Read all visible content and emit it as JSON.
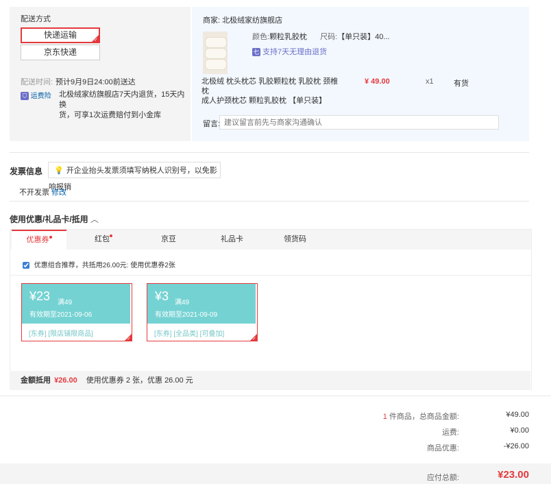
{
  "shipping": {
    "title": "配送方式",
    "options": [
      "快递运输",
      "京东快递"
    ],
    "selected_index": 0,
    "delivery_time_label": "配送时间:",
    "delivery_time_value": "预计9月9日24:00前送达",
    "insurance_badge": "运费险",
    "insurance_text_line1": "北极绒家纺旗舰店7天内退货，15天内换",
    "insurance_text_line2": "货，可享1次运费赔付到小金库"
  },
  "order": {
    "merchant_label": "商家:",
    "merchant_name": "北极绒家纺旗舰店",
    "color_label": "颜色:",
    "color_value": "颗粒乳胶枕",
    "size_label": "尺码:",
    "size_value": "【单只装】40...",
    "return_badge": "七",
    "return_text": "支持7天无理由退货",
    "product_title_line1": "北极绒 枕头枕芯 乳胶颗粒枕 乳胶枕 颈椎枕",
    "product_title_line2": "成人护颈枕芯 颗粒乳胶枕 【单只装】",
    "price": "¥ 49.00",
    "quantity": "x1",
    "stock": "有货",
    "message_label": "留言:",
    "message_placeholder": "建议留言前先与商家沟通确认"
  },
  "invoice": {
    "title": "发票信息",
    "tip_text": "开企业抬头发票须填写纳税人识别号，以免影响报销",
    "status": "不开发票",
    "modify_link": "修改"
  },
  "discount": {
    "title": "使用优惠/礼品卡/抵用",
    "tabs": [
      "优惠券",
      "红包",
      "京豆",
      "礼品卡",
      "领货码"
    ],
    "active_tab_index": 0,
    "combo_checkbox_checked": true,
    "combo_text": "优惠组合推荐，共抵用26.00元: 使用优惠券2张",
    "coupons": [
      {
        "amount": "¥23",
        "threshold": "满49",
        "expiry": "有效期至2021-09-06",
        "tags": "[东券] [限店铺限商品]"
      },
      {
        "amount": "¥3",
        "threshold": "满49",
        "expiry": "有效期至2021-09-09",
        "tags": "[东券] [全品类] [可叠加]"
      }
    ],
    "footer_label": "金额抵用",
    "footer_amount": "¥26.00",
    "footer_text": "使用优惠券 2 张，优惠 26.00 元"
  },
  "summary": {
    "item_count": "1",
    "items_label": "件商品，总商品金额:",
    "items_value": "¥49.00",
    "freight_label": "运费:",
    "freight_value": "¥0.00",
    "promo_label": "商品优惠:",
    "promo_value": "-¥26.00",
    "total_label": "应付总额:",
    "total_value": "¥23.00"
  },
  "colors": {
    "accent_red": "#e4393c",
    "coupon_teal": "#75d2d3",
    "link_blue": "#005ea7"
  }
}
